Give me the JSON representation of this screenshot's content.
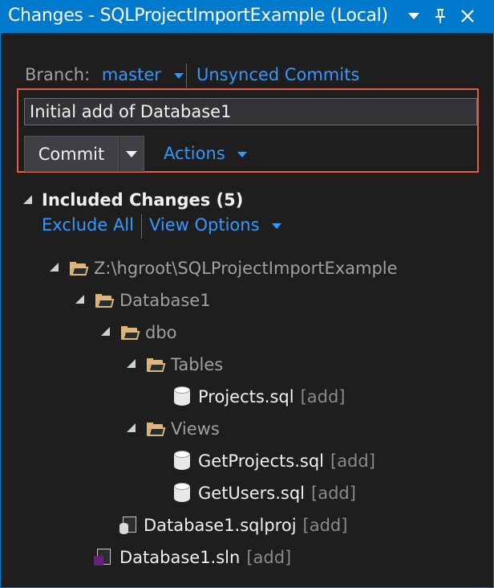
{
  "window": {
    "title": "Changes - SQLProjectImportExample (Local)",
    "accent": "#007acc"
  },
  "branch": {
    "label": "Branch:",
    "name": "master",
    "unsynced_link": "Unsynced Commits"
  },
  "commit": {
    "message": "Initial add of Database1",
    "button_label": "Commit",
    "actions_label": "Actions"
  },
  "included": {
    "header": "Included Changes (5)",
    "exclude_all": "Exclude All",
    "view_options": "View Options"
  },
  "tree": {
    "root": "Z:\\hgroot\\SQLProjectImportExample",
    "database1": "Database1",
    "dbo": "dbo",
    "tables": "Tables",
    "projects_sql": "Projects.sql",
    "views": "Views",
    "getprojects_sql": "GetProjects.sql",
    "getusers_sql": "GetUsers.sql",
    "sqlproj": "Database1.sqlproj",
    "sln": "Database1.sln",
    "add_tag": "[add]"
  },
  "icons": [
    "dropdown-arrow-icon",
    "pin-icon",
    "close-icon",
    "folder-icon",
    "database-file-icon",
    "sql-project-icon",
    "solution-icon",
    "expander-icon"
  ]
}
